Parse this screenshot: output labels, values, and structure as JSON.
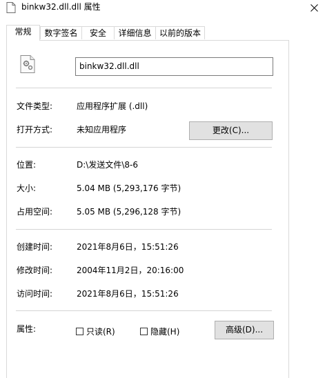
{
  "window": {
    "title": "binkw32.dll.dll 属性",
    "close_icon": "close-icon"
  },
  "tabs": [
    {
      "label": "常规",
      "active": true
    },
    {
      "label": "数字签名"
    },
    {
      "label": "安全"
    },
    {
      "label": "详细信息"
    },
    {
      "label": "以前的版本"
    }
  ],
  "file": {
    "name": "binkw32.dll.dll",
    "icon": "dll-file-icon"
  },
  "fields": {
    "type": {
      "label": "文件类型:",
      "value": "应用程序扩展 (.dll)"
    },
    "opens_with": {
      "label": "打开方式:",
      "value": "未知应用程序",
      "button": "更改(C)..."
    },
    "location": {
      "label": "位置:",
      "value": "D:\\发送文件\\8-6"
    },
    "size": {
      "label": "大小:",
      "value": "5.04 MB (5,293,176 字节)"
    },
    "size_on_disk": {
      "label": "占用空间:",
      "value": "5.05 MB (5,296,128 字节)"
    },
    "created": {
      "label": "创建时间:",
      "value": "2021年8月6日，15:51:26"
    },
    "modified": {
      "label": "修改时间:",
      "value": "2004年11月2日，20:16:00"
    },
    "accessed": {
      "label": "访问时间:",
      "value": "2021年8月6日，15:51:26"
    }
  },
  "attributes": {
    "label": "属性:",
    "readonly": {
      "label": "只读(R)",
      "checked": false
    },
    "hidden": {
      "label": "隐藏(H)",
      "checked": false
    },
    "advanced_button": "高级(D)..."
  }
}
